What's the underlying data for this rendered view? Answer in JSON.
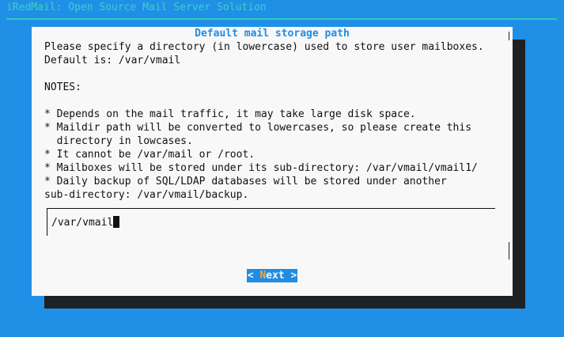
{
  "backtitle": "iRedMail: Open Source Mail Server Solution",
  "dialog": {
    "title": "Default mail storage path",
    "lines": [
      "Please specify a directory (in lowercase) used to store user mailboxes.",
      "Default is: /var/vmail",
      "",
      "NOTES:",
      "",
      "* Depends on the mail traffic, it may take large disk space.",
      "* Maildir path will be converted to lowercases, so please create this",
      "  directory in lowcases.",
      "* It cannot be /var/mail or /root.",
      "* Mailboxes will be stored under its sub-directory: /var/vmail/vmail1/",
      "* Daily backup of SQL/LDAP databases will be stored under another",
      "sub-directory: /var/vmail/backup."
    ],
    "input_value": "/var/vmail",
    "next_button": {
      "prefix": "< ",
      "hotkey": "N",
      "rest": "ext",
      "suffix": " >"
    }
  },
  "colors": {
    "screen_bg": "#1f90e6",
    "dialog_bg": "#f8f8f8",
    "title": "#1f8de3",
    "button_bg": "#1f8de3",
    "hotkey": "#f0a64a",
    "backtitle": "#3fd0c2"
  }
}
